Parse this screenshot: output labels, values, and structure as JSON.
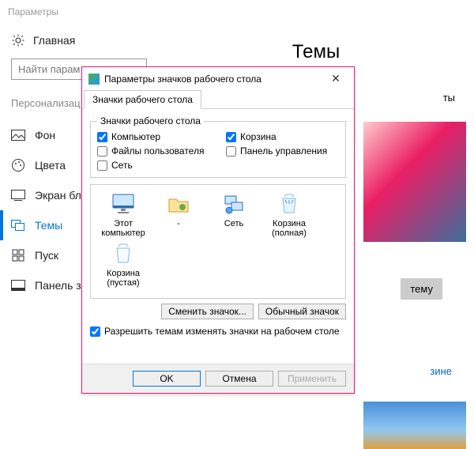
{
  "app_title": "Параметры",
  "home_label": "Главная",
  "search_placeholder": "Найти парам",
  "section_label": "Персонализац",
  "nav": {
    "background": "Фон",
    "colors": "Цвета",
    "lockscreen": "Экран бл",
    "themes": "Темы",
    "start": "Пуск",
    "taskbar": "Панель за"
  },
  "page_heading": "Темы",
  "right_fragment": "ты",
  "apply_theme_btn": "тему",
  "store_link_fragment": "зине",
  "dialog": {
    "title": "Параметры значков рабочего стола",
    "tab": "Значки рабочего стола",
    "group_legend": "Значки рабочего стола",
    "checks": {
      "computer": "Компьютер",
      "recyclebin": "Корзина",
      "userfiles": "Файлы пользователя",
      "controlpanel": "Панель управления",
      "network": "Сеть"
    },
    "icons": {
      "thispc": "Этот компьютер",
      "user": "-",
      "network": "Сеть",
      "bin_full": "Корзина (полная)",
      "bin_empty": "Корзина (пустая)"
    },
    "change_icon": "Сменить значок...",
    "default_icon": "Обычный значок",
    "allow_themes": "Разрешить темам изменять значки на рабочем столе",
    "ok": "OK",
    "cancel": "Отмена",
    "apply": "Применить"
  }
}
